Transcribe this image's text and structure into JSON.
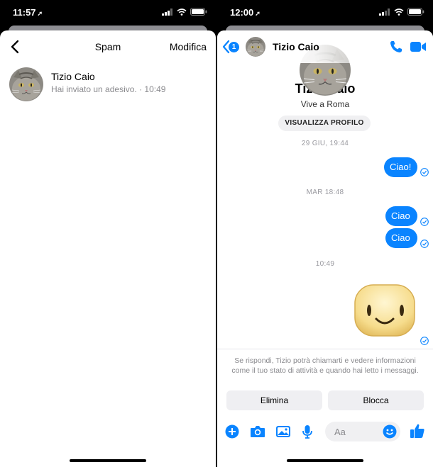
{
  "colors": {
    "accent": "#0a84ff",
    "bubble": "#0a84ff",
    "gray_text": "#8a8a8e"
  },
  "left": {
    "status": {
      "time": "11:57"
    },
    "nav": {
      "title": "Spam",
      "edit_label": "Modifica"
    },
    "conversation": {
      "name": "Tizio Caio",
      "preview": "Hai inviato un adesivo.",
      "time": "10:49"
    }
  },
  "right": {
    "status": {
      "time": "12:00"
    },
    "header": {
      "back_badge": "1",
      "name": "Tizio Caio"
    },
    "profile": {
      "name": "Tizio Caio",
      "city": "Vive a Roma",
      "button_label": "VISUALIZZA PROFILO"
    },
    "messages": [
      {
        "timestamp": "29 GIU, 19:44"
      },
      {
        "text": "Ciao!"
      },
      {
        "timestamp": "MAR 18:48"
      },
      {
        "text": "Ciao"
      },
      {
        "text": "Ciao"
      },
      {
        "timestamp": "10:49"
      }
    ],
    "disclaimer": "Se rispondi, Tizio potrà chiamarti e vedere informazioni come il tuo stato di attività e quando hai letto i messaggi.",
    "actions": {
      "delete_label": "Elimina",
      "block_label": "Blocca"
    },
    "composer": {
      "placeholder": "Aa"
    },
    "icons": [
      "add-icon",
      "camera-icon",
      "gallery-icon",
      "microphone-icon",
      "emoji-icon",
      "thumbs-up-icon",
      "phone-icon",
      "video-icon"
    ]
  }
}
